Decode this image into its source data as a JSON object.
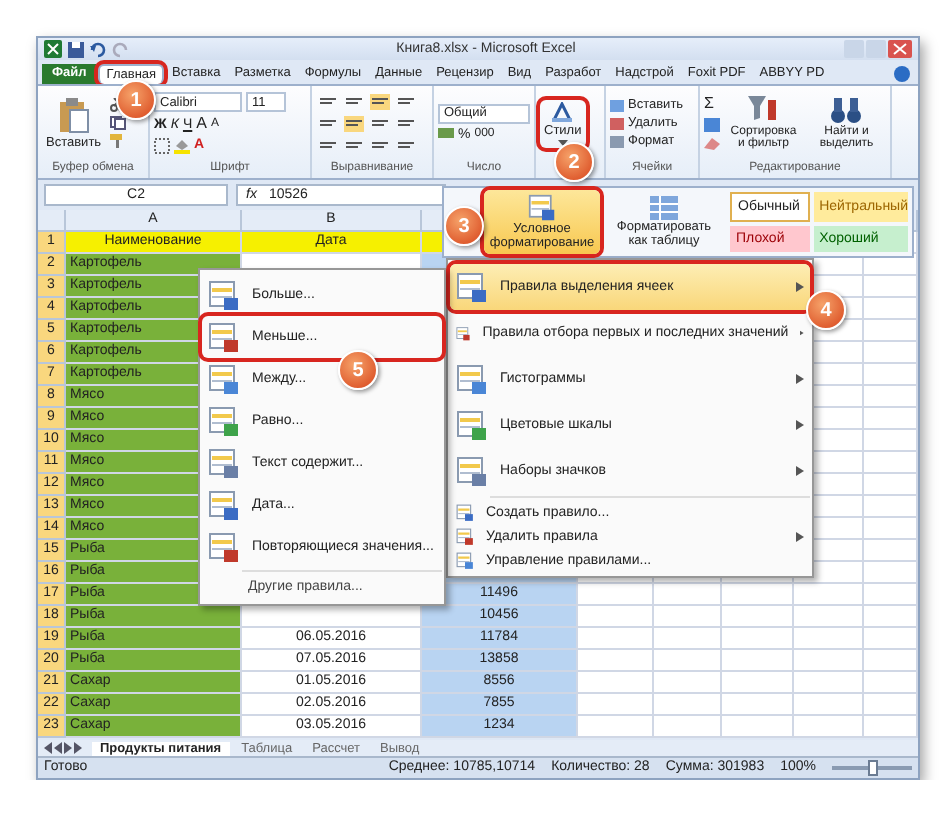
{
  "window": {
    "title": "Книга8.xlsx - Microsoft Excel"
  },
  "tabs": [
    {
      "label": "Файл",
      "kind": "file",
      "selected": false,
      "outlined": false
    },
    {
      "label": "Главная",
      "kind": "tab",
      "selected": true,
      "outlined": true
    },
    {
      "label": "Вставка",
      "kind": "tab",
      "selected": false,
      "outlined": false
    },
    {
      "label": "Разметка",
      "kind": "tab",
      "selected": false,
      "outlined": false
    },
    {
      "label": "Формулы",
      "kind": "tab",
      "selected": false,
      "outlined": false
    },
    {
      "label": "Данные",
      "kind": "tab",
      "selected": false,
      "outlined": false
    },
    {
      "label": "Рецензир",
      "kind": "tab",
      "selected": false,
      "outlined": false
    },
    {
      "label": "Вид",
      "kind": "tab",
      "selected": false,
      "outlined": false
    },
    {
      "label": "Разработ",
      "kind": "tab",
      "selected": false,
      "outlined": false
    },
    {
      "label": "Надстрой",
      "kind": "tab",
      "selected": false,
      "outlined": false
    },
    {
      "label": "Foxit PDF",
      "kind": "tab",
      "selected": false,
      "outlined": false
    },
    {
      "label": "ABBYY PD",
      "kind": "tab",
      "selected": false,
      "outlined": false
    }
  ],
  "ribbon": {
    "groups": [
      {
        "kind": "clipboard",
        "label": "Буфер обмена",
        "button": "Вставить"
      },
      {
        "kind": "font",
        "label": "Шрифт",
        "font": "Calibri",
        "size": "11",
        "styles": [
          "Ж",
          "К",
          "Ч"
        ],
        "grow": "A",
        "shrink": "A",
        "font_color": "A"
      },
      {
        "kind": "alignment",
        "label": "Выравнивание"
      },
      {
        "kind": "number",
        "label": "Число",
        "format": "Общий",
        "percent": "%",
        "thousands": "000"
      },
      {
        "kind": "styles",
        "button": "Стили",
        "outlined": true
      },
      {
        "kind": "cells",
        "label": "Ячейки",
        "items": [
          "Вставить",
          "Удалить",
          "Формат"
        ]
      },
      {
        "kind": "editing",
        "label": "Редактирование",
        "sum": "Σ",
        "items": [
          "Сортировка и фильтр",
          "Найти и выделить"
        ]
      }
    ]
  },
  "formula_bar": {
    "cell": "C2",
    "fx": "fx",
    "value": "10526"
  },
  "grid": {
    "columns": [
      "A",
      "B"
    ],
    "rows": [
      {
        "n": "1",
        "kind": "header",
        "a": "Наименование",
        "b": "Дата"
      },
      {
        "n": "2",
        "kind": "data",
        "a": "Картофель"
      },
      {
        "n": "3",
        "kind": "data",
        "a": "Картофель"
      },
      {
        "n": "4",
        "kind": "data",
        "a": "Картофель"
      },
      {
        "n": "5",
        "kind": "data",
        "a": "Картофель"
      },
      {
        "n": "6",
        "kind": "data",
        "a": "Картофель"
      },
      {
        "n": "7",
        "kind": "data",
        "a": "Картофель"
      },
      {
        "n": "8",
        "kind": "data",
        "a": "Мясо"
      },
      {
        "n": "9",
        "kind": "data",
        "a": "Мясо"
      },
      {
        "n": "10",
        "kind": "data",
        "a": "Мясо"
      },
      {
        "n": "11",
        "kind": "data",
        "a": "Мясо"
      },
      {
        "n": "12",
        "kind": "data",
        "a": "Мясо"
      },
      {
        "n": "13",
        "kind": "data",
        "a": "Мясо"
      },
      {
        "n": "14",
        "kind": "data",
        "a": "Мясо"
      },
      {
        "n": "15",
        "kind": "data",
        "a": "Рыба"
      },
      {
        "n": "16",
        "kind": "data",
        "a": "Рыба"
      },
      {
        "n": "17",
        "kind": "data",
        "a": "Рыба",
        "c": "11496"
      },
      {
        "n": "18",
        "kind": "data",
        "a": "Рыба",
        "c": "10456"
      },
      {
        "n": "19",
        "kind": "data",
        "a": "Рыба",
        "b": "06.05.2016",
        "c": "11784"
      },
      {
        "n": "20",
        "kind": "data",
        "a": "Рыба",
        "b": "07.05.2016",
        "c": "13858"
      },
      {
        "n": "21",
        "kind": "data",
        "a": "Сахар",
        "b": "01.05.2016",
        "c": "8556"
      },
      {
        "n": "22",
        "kind": "data",
        "a": "Сахар",
        "b": "02.05.2016",
        "c": "7855"
      },
      {
        "n": "23",
        "kind": "data",
        "a": "Сахар",
        "b": "03.05.2016",
        "c": "1234"
      }
    ]
  },
  "sheets": [
    {
      "label": "Продукты питания",
      "selected": true
    },
    {
      "label": "Таблица",
      "selected": false
    },
    {
      "label": "Рассчет",
      "selected": false
    },
    {
      "label": "Вывод",
      "selected": false
    }
  ],
  "status_bar": {
    "ready": "Готово",
    "average": "Среднее: 10785,10714",
    "count": "Количество: 28",
    "sum": "Сумма: 301983",
    "zoom": "100%",
    "level": 0.5
  },
  "styles_panel": {
    "conditional": {
      "label": "Условное форматирование",
      "outlined": true
    },
    "format_table": "Форматировать как таблицу",
    "styles": [
      {
        "label": "Обычный",
        "kind": "normal"
      },
      {
        "label": "Нейтральный",
        "kind": "neutral"
      },
      {
        "label": "Плохой",
        "kind": "bad"
      },
      {
        "label": "Хороший",
        "kind": "good"
      }
    ]
  },
  "cf_menu": {
    "items": [
      {
        "label": "Правила выделения ячеек",
        "kind": "large",
        "submenu": true,
        "highlighted": true,
        "outlined": true
      },
      {
        "label": "Правила отбора первых и последних значений",
        "kind": "large",
        "submenu": true,
        "highlighted": false,
        "outlined": false
      },
      {
        "label": "Гистограммы",
        "kind": "large",
        "submenu": true,
        "highlighted": false,
        "outlined": false
      },
      {
        "label": "Цветовые шкалы",
        "kind": "large",
        "submenu": true,
        "highlighted": false,
        "outlined": false
      },
      {
        "label": "Наборы значков",
        "kind": "large",
        "submenu": true,
        "highlighted": false,
        "outlined": false
      },
      {
        "label": "Создать правило...",
        "kind": "small",
        "submenu": false,
        "highlighted": false,
        "outlined": false
      },
      {
        "label": "Удалить правила",
        "kind": "small",
        "submenu": true,
        "highlighted": false,
        "outlined": false
      },
      {
        "label": "Управление правилами...",
        "kind": "small",
        "submenu": false,
        "highlighted": false,
        "outlined": false
      }
    ]
  },
  "rules_submenu": {
    "items": [
      {
        "label": "Больше...",
        "outlined": false
      },
      {
        "label": "Меньше...",
        "outlined": true
      },
      {
        "label": "Между...",
        "outlined": false
      },
      {
        "label": "Равно...",
        "outlined": false
      },
      {
        "label": "Текст содержит...",
        "outlined": false
      },
      {
        "label": "Дата...",
        "outlined": false
      },
      {
        "label": "Повторяющиеся значения...",
        "outlined": false
      }
    ],
    "footer": "Другие правила..."
  },
  "callouts": [
    "1",
    "2",
    "3",
    "4",
    "5"
  ]
}
